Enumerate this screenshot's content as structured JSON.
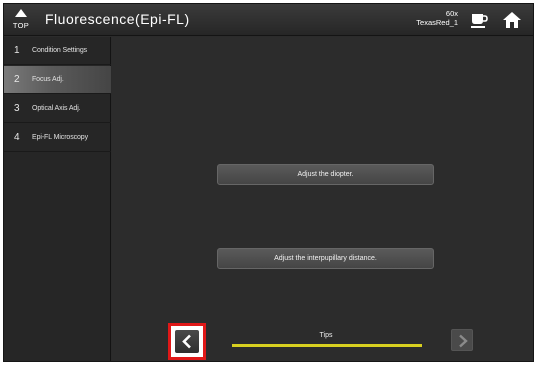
{
  "header": {
    "top_label": "TOP",
    "title": "Fluorescence(Epi-FL)",
    "status_magnification": "60x",
    "status_filter": "TexasRed_1",
    "cup_icon": "cup-icon",
    "home_icon": "home-icon",
    "top_icon": "up-triangle-icon"
  },
  "sidebar": {
    "items": [
      {
        "num": "1",
        "label": "Condition Settings",
        "active": false
      },
      {
        "num": "2",
        "label": "Focus Adj.",
        "active": true
      },
      {
        "num": "3",
        "label": "Optical Axis Adj.",
        "active": false
      },
      {
        "num": "4",
        "label": "Epi-FL Microscopy",
        "active": false
      }
    ]
  },
  "main": {
    "buttons": [
      {
        "label": "Adjust the diopter."
      },
      {
        "label": "Adjust the interpupillary distance."
      }
    ]
  },
  "footer": {
    "prev_icon": "chevron-left-icon",
    "next_icon": "chevron-right-icon",
    "tips_label": "Tips"
  },
  "colors": {
    "highlight_border": "#e01818",
    "tips_line": "#d8d020",
    "background": "#2b2b2b"
  }
}
